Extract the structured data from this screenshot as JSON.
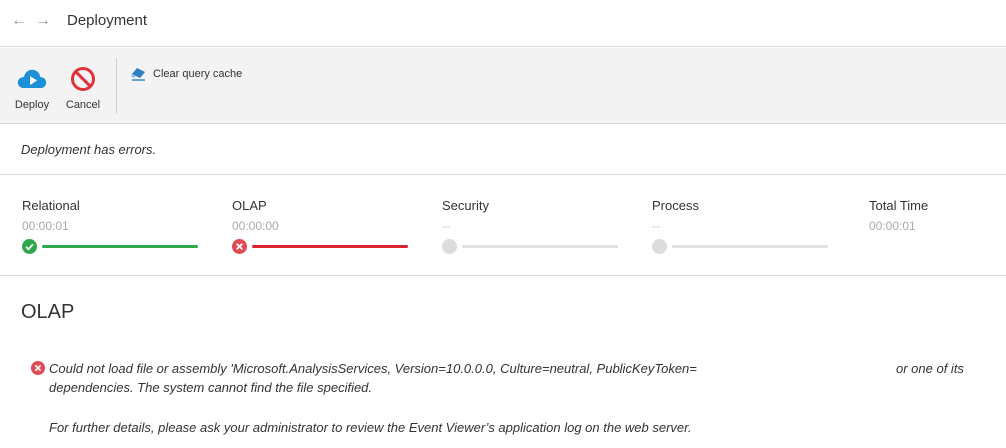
{
  "header": {
    "title": "Deployment",
    "back_icon": "arrow-left-icon",
    "forward_icon": "arrow-right-icon"
  },
  "toolbar": {
    "deploy_label": "Deploy",
    "cancel_label": "Cancel",
    "clear_cache_label": "Clear query cache"
  },
  "status": {
    "message": "Deployment has errors."
  },
  "steps": [
    {
      "name": "Relational",
      "time": "00:00:01",
      "state": "success",
      "color": "#2ea84a"
    },
    {
      "name": "OLAP",
      "time": "00:00:00",
      "state": "error",
      "color": "#d9262f"
    },
    {
      "name": "Security",
      "time": "--",
      "state": "pending",
      "color": "#dcdcdc"
    },
    {
      "name": "Process",
      "time": "--",
      "state": "pending",
      "color": "#dcdcdc"
    }
  ],
  "total": {
    "name": "Total Time",
    "time": "00:00:01"
  },
  "section": {
    "title": "OLAP",
    "error_line1": "Could not load file or assembly 'Microsoft.AnalysisServices, Version=10.0.0.0, Culture=neutral, PublicKeyToken=",
    "error_line1_tail": "or one of its",
    "error_line2": "dependencies. The system cannot find the file specified.",
    "error_line3": "For further details, please ask your administrator to review the Event Viewer’s application log on the web server."
  },
  "colors": {
    "deploy_blue": "#1e90d8",
    "cancel_red": "#e0323a",
    "eraser_blue": "#2a7fc0"
  }
}
